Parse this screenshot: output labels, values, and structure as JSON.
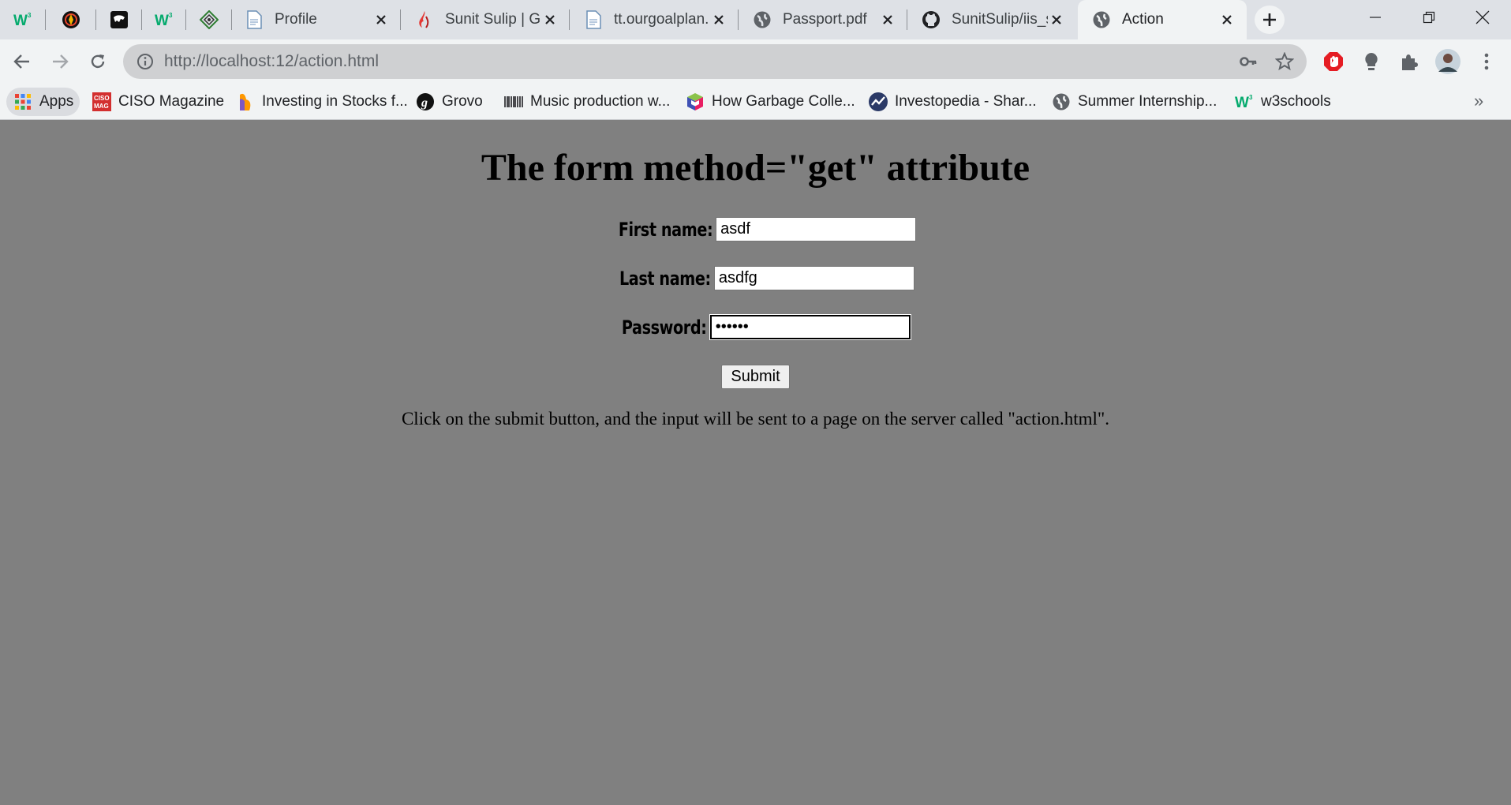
{
  "browser": {
    "tabs": [
      {
        "title": "",
        "icon": "w3schools-icon"
      },
      {
        "title": "",
        "icon": "compass-icon"
      },
      {
        "title": "",
        "icon": "panther-icon"
      },
      {
        "title": "",
        "icon": "w3schools-icon"
      },
      {
        "title": "",
        "icon": "diamond-icon"
      },
      {
        "title": "Profile",
        "icon": "document-icon"
      },
      {
        "title": "Sunit Sulip | Gc",
        "icon": "flame-icon"
      },
      {
        "title": "tt.ourgoalplan.",
        "icon": "document-icon"
      },
      {
        "title": "Passport.pdf",
        "icon": "globe-icon"
      },
      {
        "title": "SunitSulip/iis_s",
        "icon": "github-icon"
      },
      {
        "title": "Action",
        "icon": "globe-icon",
        "active": true
      }
    ],
    "url": "http://localhost:12/action.html",
    "bookmarks": [
      {
        "label": "Apps",
        "icon": "apps-grid-icon"
      },
      {
        "label": "CISO Magazine",
        "icon": "ciso-mag-icon"
      },
      {
        "label": "Investing in Stocks f...",
        "icon": "stocks-icon"
      },
      {
        "label": "Grovo",
        "icon": "grovo-icon"
      },
      {
        "label": "Music production w...",
        "icon": "barcode-icon"
      },
      {
        "label": "How Garbage Colle...",
        "icon": "cube-icon"
      },
      {
        "label": "Investopedia - Shar...",
        "icon": "investopedia-icon"
      },
      {
        "label": "Summer Internship...",
        "icon": "globe-icon"
      },
      {
        "label": "w3schools",
        "icon": "w3schools-icon"
      }
    ],
    "overflow": "»"
  },
  "page": {
    "heading": "The form method=\"get\" attribute",
    "first_name_label": "First name:",
    "first_name_value": "asdf",
    "last_name_label": "Last name:",
    "last_name_value": "asdfg",
    "password_label": "Password:",
    "password_value": "••••••",
    "submit_label": "Submit",
    "note": "Click on the submit button, and the input will be sent to a page on the server called \"action.html\"."
  }
}
